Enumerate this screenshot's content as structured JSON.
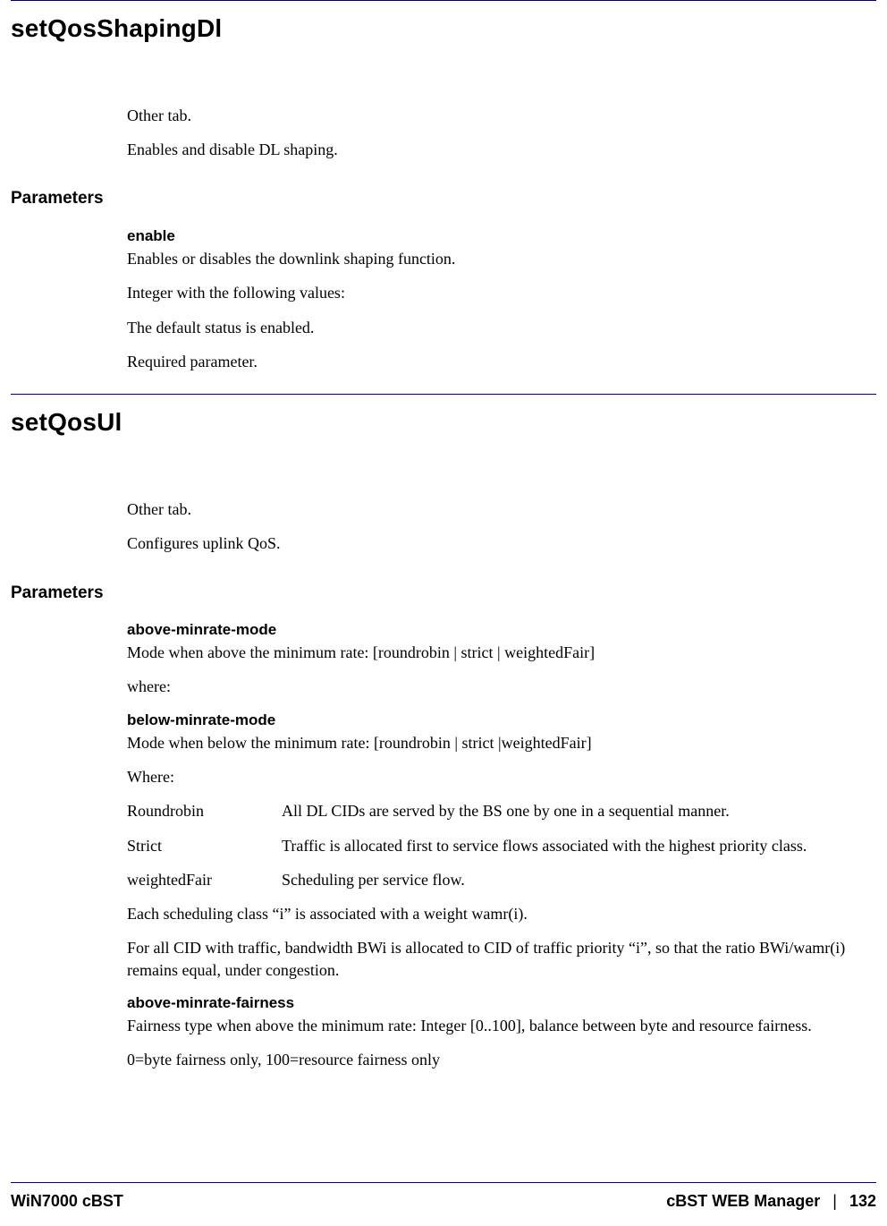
{
  "section1": {
    "heading": "setQosShapingDl",
    "intro": [
      "Other tab.",
      "Enables and disable DL shaping."
    ],
    "parameters_label": "Parameters",
    "params": {
      "enable": {
        "name": "enable",
        "desc": "Enables or disables the downlink shaping function.",
        "lines": [
          "Integer with the following values:",
          "The default status is enabled.",
          "Required parameter."
        ]
      }
    }
  },
  "section2": {
    "heading": "setQosUl",
    "intro": [
      "Other tab.",
      "Configures uplink QoS."
    ],
    "parameters_label": "Parameters",
    "params": {
      "above_minrate_mode": {
        "name": "above-minrate-mode",
        "desc": "Mode when above the minimum rate: [roundrobin | strict | weightedFair]",
        "after": "where:"
      },
      "below_minrate_mode": {
        "name": "below-minrate-mode",
        "desc": "Mode when below the minimum rate: [roundrobin | strict |weightedFair]",
        "after": "Where:",
        "defs": [
          {
            "term": "Roundrobin",
            "def": "All DL CIDs are served by the BS one by one in a sequential manner."
          },
          {
            "term": "Strict",
            "def": "Traffic is allocated first to service flows associated with the highest priority class."
          },
          {
            "term": "weightedFair",
            "def": "Scheduling per service flow."
          }
        ],
        "notes": [
          "Each scheduling class “i” is associated with a weight wamr(i).",
          "For all CID with traffic, bandwidth BWi is allocated to CID of traffic priority “i”, so that the ratio BWi/wamr(i) remains equal, under congestion."
        ]
      },
      "above_minrate_fairness": {
        "name": "above-minrate-fairness",
        "desc": "Fairness type when above the minimum rate: Integer [0..100], balance between byte and resource fairness.",
        "after": "0=byte fairness only, 100=resource fairness only"
      }
    }
  },
  "footer": {
    "left": "WiN7000 cBST",
    "right_title": "cBST WEB Manager",
    "sep": "|",
    "page": "132"
  }
}
